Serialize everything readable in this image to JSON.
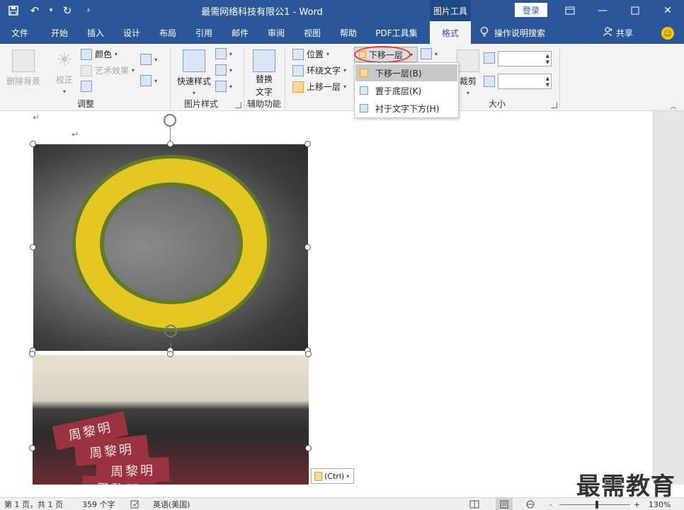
{
  "titlebar": {
    "doc_title": "最需网络科技有限公1  -  Word",
    "tools_title": "图片工具",
    "login_label": "登录",
    "qat": {
      "save_icon": "save-icon",
      "undo_icon": "undo-icon",
      "redo_icon": "redo-icon",
      "customize_icon": "customize-icon"
    }
  },
  "tabs": [
    {
      "label": "文件"
    },
    {
      "label": "开始"
    },
    {
      "label": "插入"
    },
    {
      "label": "设计"
    },
    {
      "label": "布局"
    },
    {
      "label": "引用"
    },
    {
      "label": "邮件"
    },
    {
      "label": "审阅"
    },
    {
      "label": "视图"
    },
    {
      "label": "帮助"
    },
    {
      "label": "PDF工具集"
    },
    {
      "label": "格式"
    }
  ],
  "tellme": {
    "label": "操作说明搜索"
  },
  "share": {
    "label": "共享"
  },
  "ribbon": {
    "adjust": {
      "remove_bg": "删除背景",
      "correct": "校正",
      "color": "颜色",
      "artistic": "艺术效果",
      "group_label": "调整"
    },
    "picture_styles": {
      "quick_styles": "快速样式",
      "group_label": "图片样式"
    },
    "accessibility": {
      "alt_text_line1": "替换",
      "alt_text_line2": "文字",
      "group_label": "辅助功能"
    },
    "arrange": {
      "position": "位置",
      "wrap_text": "环绕文字",
      "bring_forward": "上移一层",
      "send_backward": "下移一层",
      "crop": "裁剪"
    },
    "size": {
      "height_value": "",
      "width_value": "",
      "group_label": "大小"
    }
  },
  "dropdown": {
    "items": [
      {
        "label": "下移一层(B)",
        "hover": true
      },
      {
        "label": "置于底层(K)",
        "hover": false
      },
      {
        "label": "衬于文字下方(H)",
        "hover": false
      }
    ]
  },
  "document": {
    "paste_options": "(Ctrl)",
    "image2_cards": [
      "周黎明",
      "周黎明",
      "周黎明",
      "周黎明"
    ]
  },
  "status": {
    "page": "第 1 页，共 1 页",
    "words": "359 个字",
    "language": "英语(美国)",
    "zoom": "130%",
    "zoom_minus": "-",
    "zoom_plus": "+"
  },
  "watermark": "最需教育",
  "colors": {
    "accent": "#2b579a",
    "highlight_ring": "#e53935"
  }
}
